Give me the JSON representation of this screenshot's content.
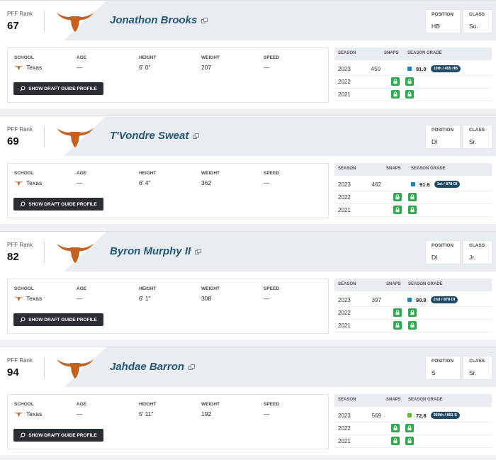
{
  "labels": {
    "pff_rank": "PFF Rank",
    "position": "POSITION",
    "class": "CLASS",
    "school": "SCHOOL",
    "age": "AGE",
    "height": "HEIGHT",
    "weight": "WEIGHT",
    "speed": "SPEED",
    "draft_button": "SHOW DRAFT GUIDE PROFILE",
    "season": "SEASON",
    "snaps": "SNAPS",
    "season_grade": "SEASON GRADE"
  },
  "colors": {
    "brand_orange": "#c5611f",
    "name_blue": "#22597a",
    "grade_blue": "#1a86b5",
    "grade_green": "#5dbf2e",
    "lock_green": "#2fa84f",
    "badge_navy": "#1f4b67"
  },
  "players": [
    {
      "rank": "67",
      "name": "Jonathon Brooks",
      "position": "HB",
      "class": "So.",
      "school": "Texas",
      "age": "—",
      "height": "6' 0\"",
      "weight": "207",
      "speed": "—",
      "seasons": [
        {
          "year": "2023",
          "snaps": "450",
          "grade": "91.0",
          "grade_color": "blue",
          "badge": "10th / 455 HB",
          "locked": false
        },
        {
          "year": "2022",
          "snaps": "",
          "locked": true
        },
        {
          "year": "2021",
          "snaps": "",
          "locked": true
        }
      ]
    },
    {
      "rank": "69",
      "name": "T'Vondre Sweat",
      "position": "DI",
      "class": "Sr.",
      "school": "Texas",
      "age": "—",
      "height": "6' 4\"",
      "weight": "362",
      "speed": "—",
      "seasons": [
        {
          "year": "2023",
          "snaps": "462",
          "grade": "91.6",
          "grade_color": "blue",
          "badge": "1st / 878 DI",
          "locked": false
        },
        {
          "year": "2022",
          "snaps": "",
          "locked": true
        },
        {
          "year": "2021",
          "snaps": "",
          "locked": true
        }
      ]
    },
    {
      "rank": "82",
      "name": "Byron Murphy II",
      "position": "DI",
      "class": "Jr.",
      "school": "Texas",
      "age": "—",
      "height": "6' 1\"",
      "weight": "308",
      "speed": "—",
      "seasons": [
        {
          "year": "2023",
          "snaps": "397",
          "grade": "90.8",
          "grade_color": "blue",
          "badge": "2nd / 878 DI",
          "locked": false
        },
        {
          "year": "2022",
          "snaps": "",
          "locked": true
        },
        {
          "year": "2021",
          "snaps": "",
          "locked": true
        }
      ]
    },
    {
      "rank": "94",
      "name": "Jahdae Barron",
      "position": "S",
      "class": "Sr.",
      "school": "Texas",
      "age": "—",
      "height": "5' 11\"",
      "weight": "192",
      "speed": "—",
      "seasons": [
        {
          "year": "2023",
          "snaps": "569",
          "grade": "72.8",
          "grade_color": "green",
          "badge": "260th / 851 S",
          "locked": false
        },
        {
          "year": "2022",
          "snaps": "",
          "locked": true
        },
        {
          "year": "2021",
          "snaps": "",
          "locked": true
        }
      ]
    }
  ]
}
